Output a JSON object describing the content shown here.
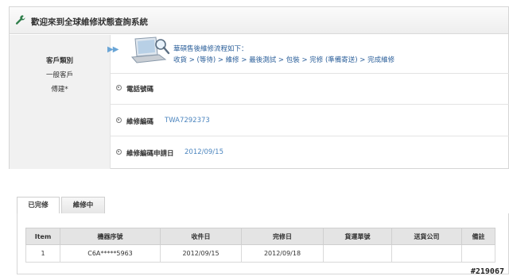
{
  "header": {
    "title": "歡迎來到全球維修狀態查詢系統"
  },
  "customer": {
    "type_label": "客戶類別",
    "type_value": "一般客戶",
    "name": "傅建*"
  },
  "flow": {
    "title": "華碩售後維修流程如下：",
    "steps": "收貨 > (等待) > 維修 > 最後測試 > 包裝 > 完修 (準備寄送) > 完成維修"
  },
  "fields": [
    {
      "label": "電話號碼",
      "value": ""
    },
    {
      "label": "維修編碼",
      "value": "TWA7292373"
    },
    {
      "label": "維修編碼申請日",
      "value": "2012/09/15"
    }
  ],
  "tabs": [
    {
      "label": "已完修",
      "active": true
    },
    {
      "label": "維修中",
      "active": false
    }
  ],
  "table": {
    "headers": [
      "Item",
      "機器序號",
      "收件日",
      "完修日",
      "貨運單號",
      "送貨公司",
      "備註"
    ],
    "rows": [
      [
        "1",
        "C6A*****5963",
        "2012/09/15",
        "2012/09/18",
        "",
        "",
        ""
      ]
    ]
  },
  "watermark": "#219067"
}
